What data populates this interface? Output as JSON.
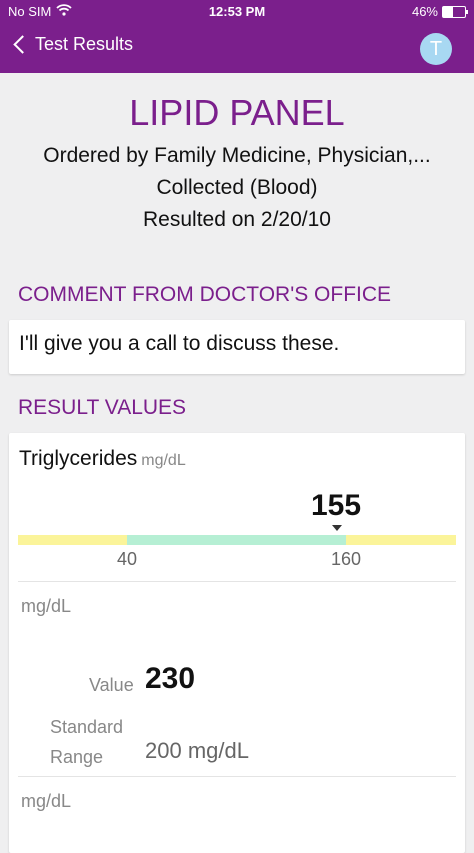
{
  "status_bar": {
    "carrier": "No SIM",
    "time": "12:53 PM",
    "battery": "46%",
    "battery_level": 0.46
  },
  "nav": {
    "back_label": "Test Results",
    "avatar_initial": "T",
    "avatar_color": "#a8d8f2",
    "accent_color": "#7b1f8c"
  },
  "header": {
    "title": "LIPID PANEL",
    "ordered_by": "Ordered by Family Medicine, Physician,...",
    "collected": "Collected (Blood)",
    "resulted": "Resulted on 2/20/10"
  },
  "comment": {
    "heading": "COMMENT FROM DOCTOR'S OFFICE",
    "text": "I'll give you a call to discuss these."
  },
  "results": {
    "heading": "RESULT VALUES",
    "test_name": "Triglycerides",
    "test_unit": "mg/dL",
    "value": "155",
    "range_low": "40",
    "range_high": "160",
    "range_colors": {
      "out_of_range": "#fbf49a",
      "normal": "#b6efd4"
    },
    "unit_line_1": "mg/dL",
    "value_label": "Value",
    "value_number": "230",
    "standard_range_label": "Standard Range",
    "standard_range_value": "200 mg/dL",
    "unit_line_2": "mg/dL"
  }
}
